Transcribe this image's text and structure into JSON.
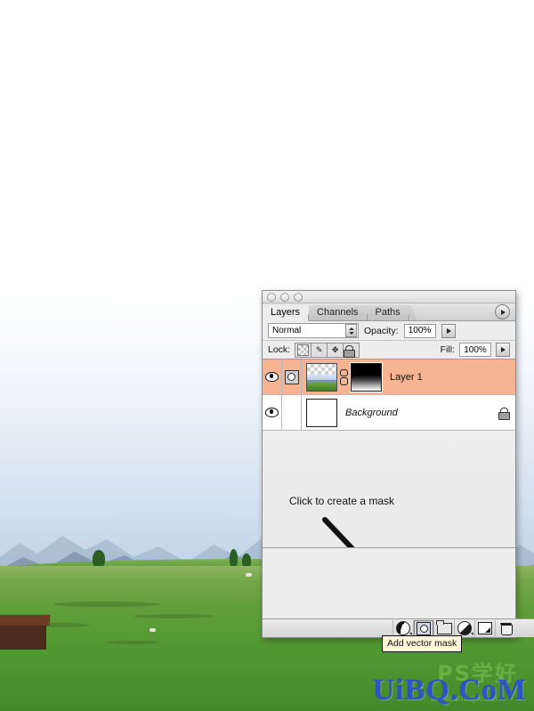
{
  "photo": {
    "description": "Alpine meadow landscape photo with gradient-masked sky",
    "sky_color_top": "#ffffff",
    "sky_color_horizon": "#c0d3e6",
    "mountain_color": "#8fa5bc",
    "field_color": "#569a33"
  },
  "watermark": {
    "text": "UiBQ.CoM",
    "color": "#2b56c4",
    "overlay_cn": "PS学好",
    "url": "www.uibq.com"
  },
  "panel": {
    "title_dots": 3,
    "tabs": [
      {
        "label": "Layers",
        "active": true
      },
      {
        "label": "Channels",
        "active": false
      },
      {
        "label": "Paths",
        "active": false
      }
    ],
    "menu_icon": "panel-menu-arrow-icon",
    "blend_mode": "Normal",
    "opacity_label": "Opacity:",
    "opacity_value": "100%",
    "fill_label": "Fill:",
    "fill_value": "100%",
    "lock_label": "Lock:",
    "lock_buttons": [
      {
        "name": "lock-transparent-pixels",
        "icon": "checkerboard-icon"
      },
      {
        "name": "lock-image-pixels",
        "icon": "brush-icon",
        "glyph": "✎"
      },
      {
        "name": "lock-position",
        "icon": "move-cross-icon",
        "glyph": "✥"
      },
      {
        "name": "lock-all",
        "icon": "lock-icon",
        "glyph": "🔒"
      }
    ],
    "layers": [
      {
        "name": "Layer 1",
        "selected": true,
        "visible": true,
        "has_mask": true,
        "linked": true,
        "locked": false,
        "italic": false,
        "thumbnail": "landscape-with-transparency",
        "mask_thumbnail": "black-to-white-gradient"
      },
      {
        "name": "Background",
        "selected": false,
        "visible": true,
        "has_mask": false,
        "linked": false,
        "locked": true,
        "italic": true,
        "thumbnail": "white"
      }
    ],
    "annotation": {
      "hint_text": "Click to create a mask",
      "arrow": "down-right-arrow-icon"
    },
    "bottom_toolbar": [
      {
        "name": "layer-style-button",
        "icon": "fx-circle-icon",
        "has_caret": true,
        "active": false
      },
      {
        "name": "add-layer-mask-button",
        "icon": "add-mask-icon",
        "has_caret": false,
        "active": true
      },
      {
        "name": "new-group-button",
        "icon": "folder-icon",
        "has_caret": false,
        "active": false
      },
      {
        "name": "new-adjustment-layer-button",
        "icon": "half-circle-icon",
        "has_caret": true,
        "active": false
      },
      {
        "name": "new-layer-button",
        "icon": "new-page-icon",
        "has_caret": false,
        "active": false
      },
      {
        "name": "delete-layer-button",
        "icon": "trash-icon",
        "has_caret": false,
        "active": false
      }
    ],
    "tooltip": "Add vector mask"
  }
}
